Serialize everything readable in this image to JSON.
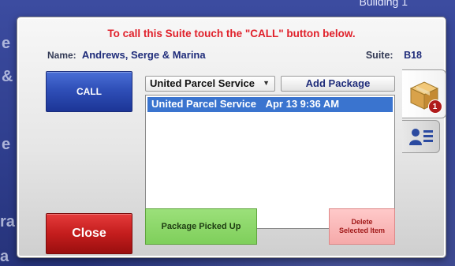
{
  "dialog": {
    "instruction": "To call this Suite touch the \"CALL\" button below.",
    "name_label": "Name:",
    "name_value": "Andrews, Serge & Marina",
    "suite_label": "Suite:",
    "suite_value": "B18"
  },
  "buttons": {
    "call_label": "CALL",
    "close_label": "Close",
    "add_package_label": "Add Package",
    "picked_up_label": "Package Picked Up",
    "delete_line1": "Delete",
    "delete_line2": "Selected Item"
  },
  "carrier_select": {
    "selected": "United Parcel Service"
  },
  "packages": [
    {
      "carrier": "United Parcel Service",
      "received": "Apr 13 9:36 AM"
    }
  ],
  "tabs": {
    "package_tab_icon": "package-box-icon",
    "package_badge_count": "1",
    "contact_tab_icon": "contact-card-icon"
  },
  "background": {
    "top_text": "Building 1",
    "left_fragments": [
      "e",
      "&",
      "e",
      "ra",
      "a"
    ]
  },
  "colors": {
    "instruction": "#e0202a",
    "call_button": "#2f4fb8",
    "close_button": "#c41d1d",
    "picked_up_button": "#7fcf5b",
    "delete_button": "#f5a9a9",
    "selected_row": "#3a74cf"
  }
}
